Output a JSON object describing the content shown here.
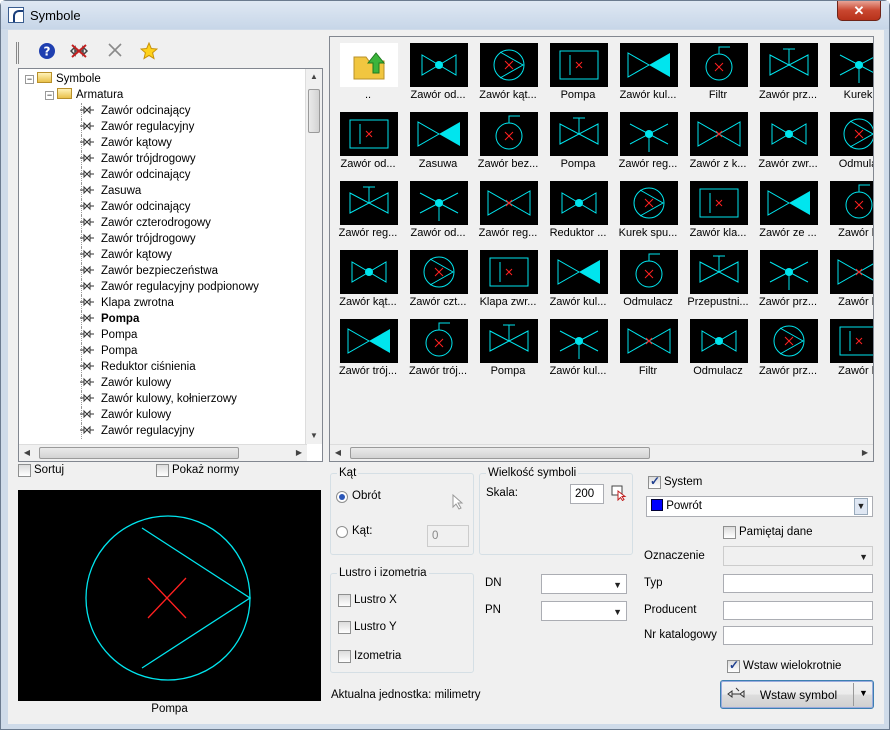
{
  "window": {
    "title": "Symbole",
    "close": "✕"
  },
  "toolbar": {
    "icons": [
      "help-icon",
      "delete-symbol-icon",
      "close-x-icon",
      "favorite-star-icon"
    ]
  },
  "tree": {
    "root": "Symbole",
    "folder": "Armatura",
    "items": [
      "Zawór odcinający",
      "Zawór regulacyjny",
      "Zawór kątowy",
      "Zawór trójdrogowy",
      "Zawór odcinający",
      "Zasuwa",
      "Zawór odcinający",
      "Zawór czterodrogowy",
      "Zawór trójdrogowy",
      "Zawór kątowy",
      "Zawór bezpieczeństwa",
      "Zawór regulacyjny podpionowy",
      "Klapa zwrotna",
      "Pompa",
      "Pompa",
      "Pompa",
      "Reduktor ciśnienia",
      "Zawór kulowy",
      "Zawór kulowy, kołnierzowy",
      "Zawór kulowy",
      "Zawór regulacyjny"
    ],
    "selected_index": 13
  },
  "symbols": [
    [
      "..",
      "Zawór od...",
      "Zawór kąt...",
      "Pompa",
      "Zawór kul...",
      "Filtr",
      "Zawór prz...",
      "Kurek"
    ],
    [
      "Zawór od...",
      "Zasuwa",
      "Zawór bez...",
      "Pompa",
      "Zawór reg...",
      "Zawór z k...",
      "Zawór zwr...",
      "Odmula"
    ],
    [
      "Zawór reg...",
      "Zawór od...",
      "Zawór reg...",
      "Reduktor ...",
      "Kurek spu...",
      "Zawór kla...",
      "Zawór ze ...",
      "Zawór b"
    ],
    [
      "Zawór kąt...",
      "Zawór czt...",
      "Klapa zwr...",
      "Zawór kul...",
      "Odmulacz",
      "Przepustni...",
      "Zawór prz...",
      "Zawór b"
    ],
    [
      "Zawór trój...",
      "Zawór trój...",
      "Pompa",
      "Zawór kul...",
      "Filtr",
      "Odmulacz",
      "Zawór prz...",
      "Zawór b"
    ]
  ],
  "options": {
    "sort": "Sortuj",
    "show_norms": "Pokaż normy"
  },
  "preview": {
    "caption": "Pompa"
  },
  "angle": {
    "title": "Kąt",
    "rotate": "Obrót",
    "angle": "Kąt:",
    "angle_value": "0"
  },
  "mirror": {
    "title": "Lustro i izometria",
    "x": "Lustro X",
    "y": "Lustro Y",
    "iso": "Izometria"
  },
  "size": {
    "title": "Wielkość symboli",
    "scale_label": "Skala:",
    "scale_value": "200"
  },
  "dn": {
    "label": "DN",
    "value": ""
  },
  "pn": {
    "label": "PN",
    "value": ""
  },
  "units": "Aktualna jednostka: milimetry",
  "system": {
    "label": "System",
    "value": "Powrót",
    "color": "#0000ff"
  },
  "remember": "Pamiętaj dane",
  "fields": {
    "oznaczenie": "Oznaczenie",
    "typ": "Typ",
    "producent": "Producent",
    "nr": "Nr katalogowy"
  },
  "multi_insert": "Wstaw wielokrotnie",
  "insert_button": "Wstaw symbol",
  "colors": {
    "symbol": "#00e5ee",
    "symbol_accent": "#ff2020"
  }
}
